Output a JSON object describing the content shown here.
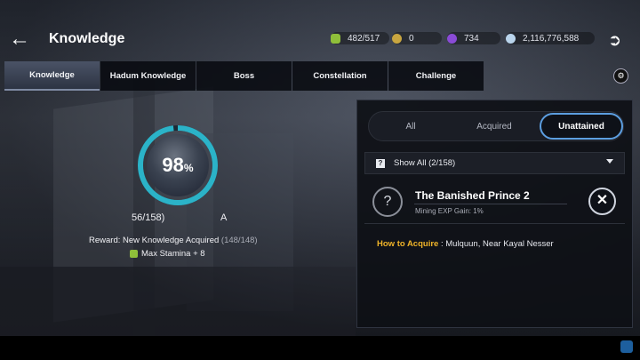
{
  "header": {
    "title": "Knowledge",
    "back_icon": "back-arrow-icon",
    "exit_icon": "exit-icon"
  },
  "resources": [
    {
      "icon": "stamina-icon",
      "value": "482/517",
      "color": "#8fbf3a"
    },
    {
      "icon": "gold-coin-icon",
      "value": "0",
      "color": "#c9a640"
    },
    {
      "icon": "purple-gem-icon",
      "value": "734",
      "color": "#8a4bd6"
    },
    {
      "icon": "silver-coin-icon",
      "value": "2,116,776,588",
      "color": "#b9d4ec"
    }
  ],
  "tabs": [
    {
      "label": "Knowledge",
      "active": true
    },
    {
      "label": "Hadum Knowledge",
      "active": false
    },
    {
      "label": "Boss",
      "active": false
    },
    {
      "label": "Constellation",
      "active": false
    },
    {
      "label": "Challenge",
      "active": false
    }
  ],
  "progress": {
    "percent": 98,
    "percent_value": "98",
    "percent_sign": "%",
    "count": "56/158)",
    "count_tail": "A",
    "reward_label": "Reward: New Knowledge Acquired",
    "reward_count": "(148/148)",
    "stamina_label": "Max Stamina + 8"
  },
  "panel": {
    "filters": {
      "all": "All",
      "acquired": "Acquired",
      "unattained": "Unattained"
    },
    "active_filter": "Unattained",
    "show_all": "Show All (2/158)",
    "entry": {
      "title": "The Banished Prince 2",
      "subtitle": "Mining EXP Gain: 1%"
    },
    "how_to_acquire_label": "How to Acquire",
    "how_to_acquire_value": " : Mulquun, Near Kayal Nesser"
  },
  "colors": {
    "accent_blue": "#5c9ee0",
    "ring": "#2bb3c8",
    "highlight": "#f0b429"
  }
}
